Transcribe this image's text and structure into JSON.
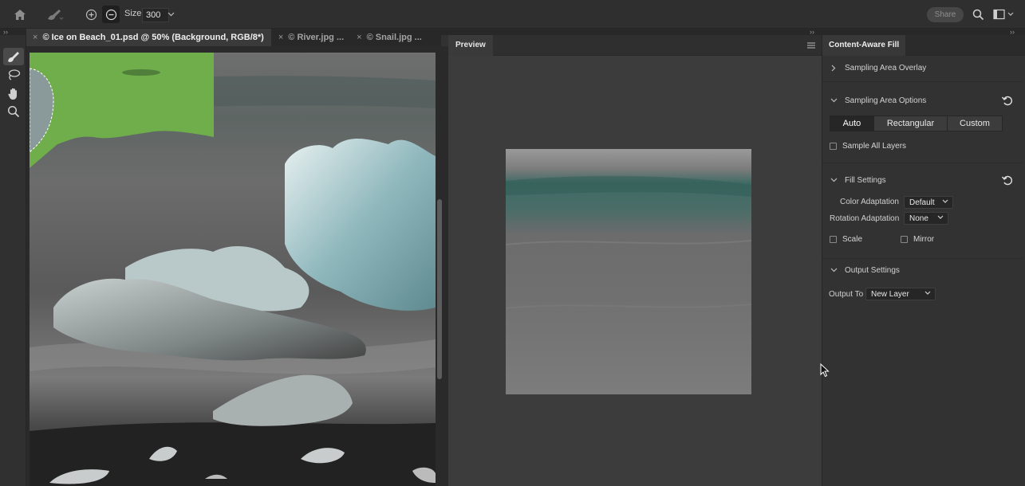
{
  "toolbar_options": {
    "size_label": "Size",
    "size_value": "300",
    "share_label": "Share"
  },
  "tools": [
    {
      "name": "sampling-brush-tool",
      "active": true
    },
    {
      "name": "lasso-tool",
      "active": false
    },
    {
      "name": "hand-tool",
      "active": false
    },
    {
      "name": "zoom-tool",
      "active": false
    }
  ],
  "document_tabs": [
    {
      "label": "© Ice on Beach_01.psd @ 50% (Background, RGB/8*)",
      "active": true
    },
    {
      "label": "© River.jpg ...",
      "active": false
    },
    {
      "label": "© Snail.jpg ...",
      "active": false
    }
  ],
  "close_glyph": "×",
  "preview": {
    "tab_label": "Preview"
  },
  "content_aware_fill": {
    "panel_title": "Content-Aware Fill",
    "sampling_area_overlay": "Sampling Area Overlay",
    "sampling_area_options": "Sampling Area Options",
    "sampling_modes": [
      "Auto",
      "Rectangular",
      "Custom"
    ],
    "selected_mode": "Auto",
    "sample_all_layers": "Sample All Layers",
    "fill_settings": "Fill Settings",
    "color_adaptation_label": "Color Adaptation",
    "color_adaptation_value": "Default",
    "rotation_adaptation_label": "Rotation Adaptation",
    "rotation_adaptation_value": "None",
    "scale_label": "Scale",
    "mirror_label": "Mirror",
    "output_settings": "Output Settings",
    "output_to_label": "Output To",
    "output_to_value": "New Layer"
  },
  "colors": {
    "accent_green": "#6fae4a",
    "panel_bg": "#323232",
    "canvas_bg": "#2a2a2a",
    "preview_bg": "#3c3c3c"
  }
}
